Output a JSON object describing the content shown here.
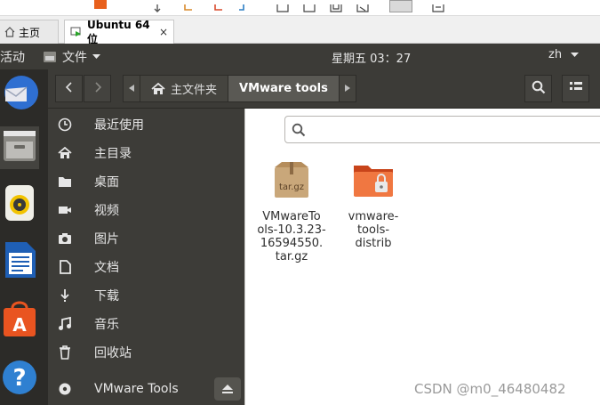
{
  "host": {
    "tabs": [
      {
        "label": "主页"
      },
      {
        "label": "Ubuntu 64 位",
        "close": "×"
      }
    ]
  },
  "topbar": {
    "activities": "活动",
    "app_menu": "文件",
    "clock": "星期五 03：27",
    "language": "zh"
  },
  "dock": {
    "items": [
      "thunderbird-icon",
      "files-icon",
      "rhythmbox-icon",
      "libreoffice-writer-icon",
      "software-center-icon",
      "help-icon"
    ]
  },
  "breadcrumb": {
    "home": "主文件夹",
    "current": "VMware tools"
  },
  "sidebar": {
    "items": [
      {
        "label": "最近使用",
        "icon": "clock-icon"
      },
      {
        "label": "主目录",
        "icon": "home-icon"
      },
      {
        "label": "桌面",
        "icon": "folder-icon"
      },
      {
        "label": "视频",
        "icon": "video-icon"
      },
      {
        "label": "图片",
        "icon": "camera-icon"
      },
      {
        "label": "文档",
        "icon": "document-icon"
      },
      {
        "label": "下载",
        "icon": "download-icon"
      },
      {
        "label": "音乐",
        "icon": "music-icon"
      },
      {
        "label": "回收站",
        "icon": "trash-icon"
      },
      {
        "label": "VMware Tools",
        "icon": "disc-icon"
      }
    ]
  },
  "files": [
    {
      "name_lines": [
        "VMwareTo",
        "ols-10.3.23-",
        "16594550.",
        "tar.gz"
      ],
      "badge": "tar.gz",
      "icon": "archive-icon"
    },
    {
      "name_lines": [
        "vmware-",
        "tools-",
        "distrib"
      ],
      "icon": "folder-locked-icon"
    }
  ],
  "watermark": "CSDN @m0_46480482",
  "colors": {
    "topbar": "#3c3b37",
    "sidebar": "#3d3c38",
    "dock": "#2c2b28",
    "ubuntu_orange": "#e95420"
  }
}
